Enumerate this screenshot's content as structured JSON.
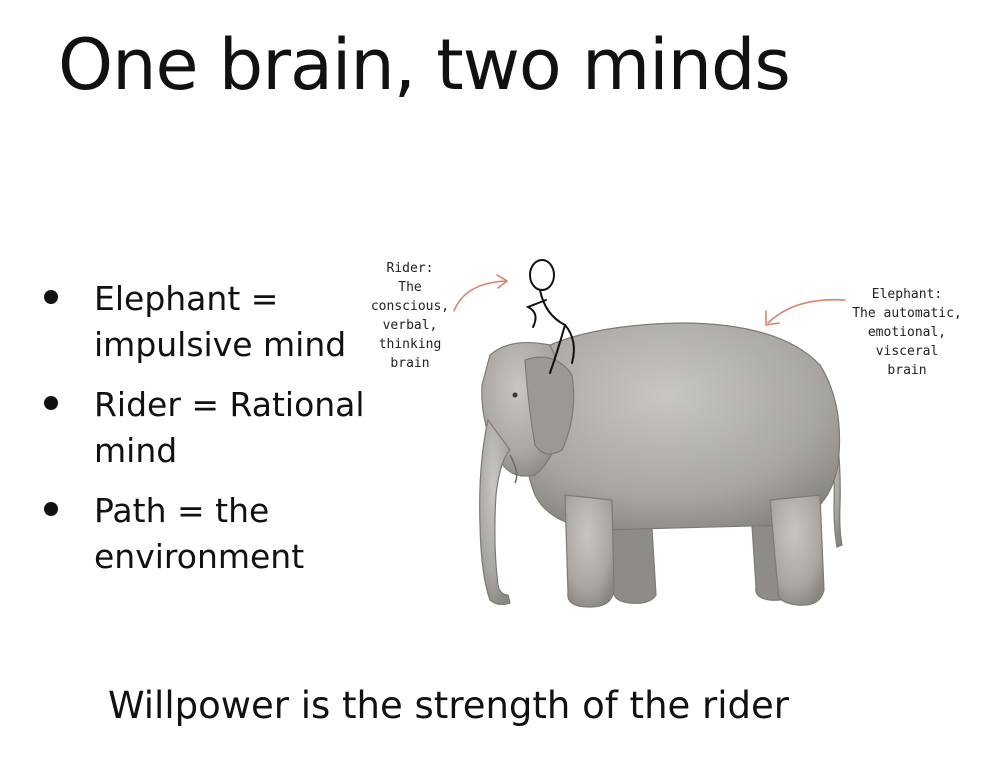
{
  "slide": {
    "title": "One brain, two minds",
    "bullets": [
      {
        "lines": [
          "Elephant =",
          "impulsive mind"
        ]
      },
      {
        "lines": [
          "Rider = Rational",
          "mind"
        ]
      },
      {
        "lines": [
          "Path = the",
          "environment"
        ]
      }
    ],
    "figure": {
      "rider_note": [
        "Rider:",
        "The",
        "conscious,",
        "verbal,",
        "thinking",
        "brain"
      ],
      "elephant_note": [
        "Elephant:",
        "The automatic,",
        "emotional,",
        "visceral",
        "brain"
      ],
      "arrow_color": "#d9826b",
      "elephant_color": "#a9a6a1"
    },
    "caption": "Willpower is the strength of the rider"
  }
}
